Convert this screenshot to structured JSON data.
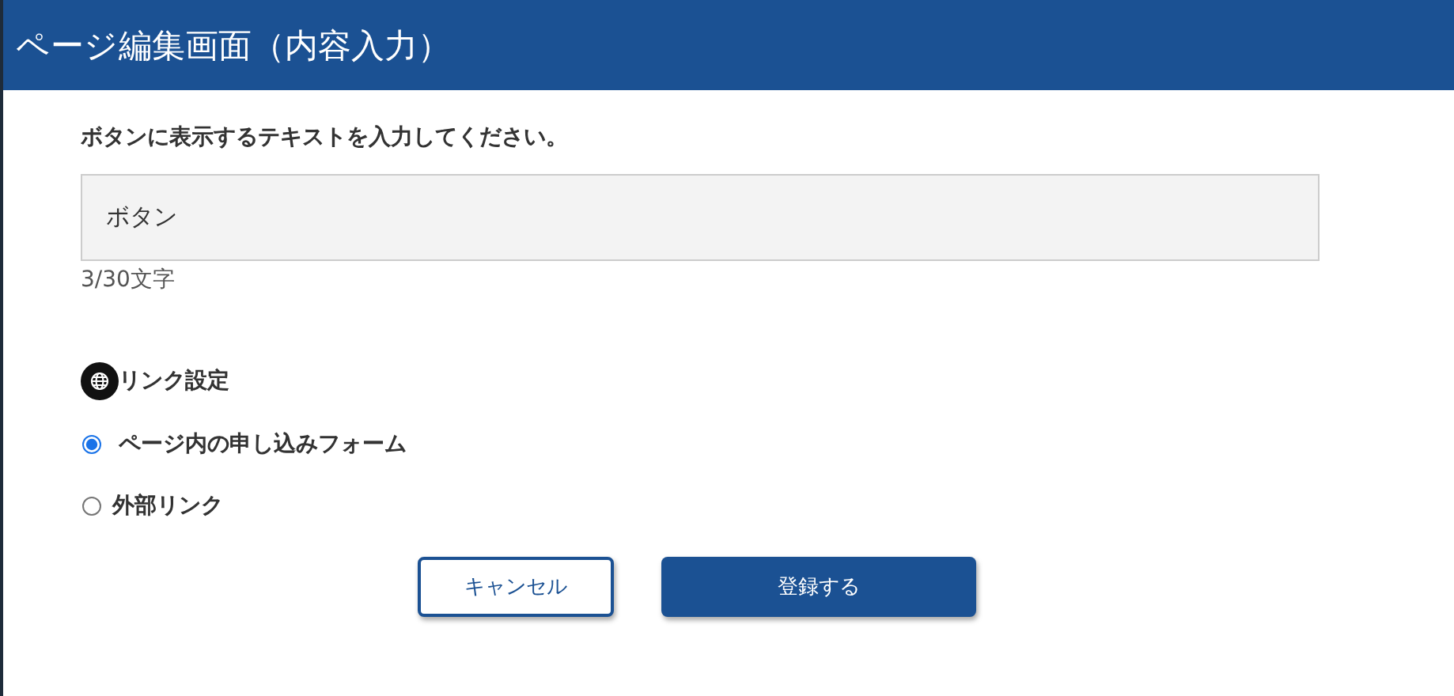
{
  "window": {
    "title": "ページ編集画面（内容入力）"
  },
  "text_field": {
    "label": "ボタンに表示するテキストを入力してください。",
    "value": "ボタン",
    "counter": "3/30文字"
  },
  "link_settings": {
    "heading": "リンク設定",
    "options": [
      {
        "label": "ページ内の申し込みフォーム",
        "selected": true
      },
      {
        "label": "外部リンク",
        "selected": false
      }
    ]
  },
  "buttons": [
    {
      "label": "キャンセル",
      "kind": "secondary"
    },
    {
      "label": "登録する",
      "kind": "primary"
    }
  ]
}
